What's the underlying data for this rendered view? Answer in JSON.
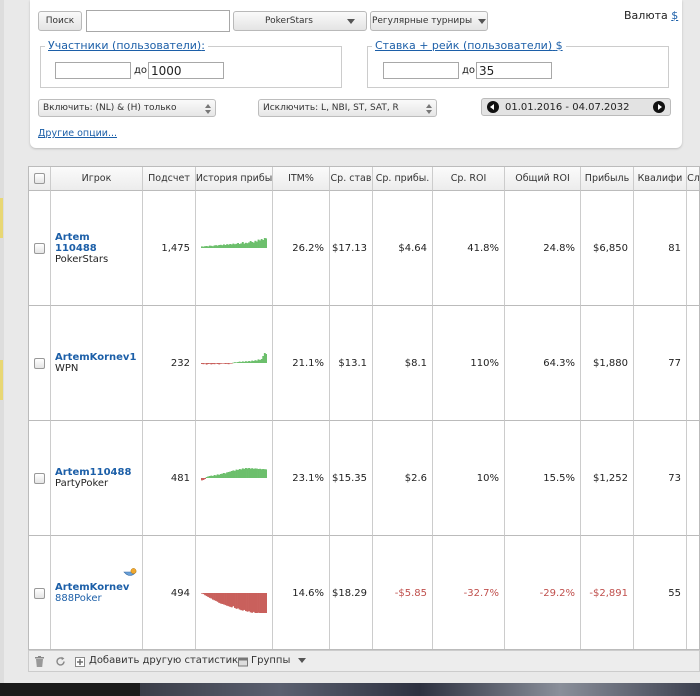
{
  "filters": {
    "search_button": "Поиск",
    "search_value": "",
    "site_select": "PokerStars",
    "tourney_select": "Регулярные турниры",
    "currency_label": "Валюта",
    "currency_symbol": "$",
    "participants": {
      "legend": "Участники (пользователи)",
      "legend_suffix": ":",
      "from": "",
      "to_label": "до",
      "to": "1000"
    },
    "stake": {
      "legend": "Ставка + рейк (пользователи)",
      "legend_symbol": "$",
      "from": "",
      "to_label": "до",
      "to": "35"
    },
    "include_select": "Включить: (NL) & (H) только",
    "exclude_select": "Исключить: L, NBI, ST, SAT, R",
    "date_range": "01.01.2016 - 04.07.2032",
    "more_options": "Другие опции..."
  },
  "table": {
    "headers": [
      "Игрок",
      "Подсчет",
      "История прибы",
      "ITM%",
      "Ср. став",
      "Ср. прибы.",
      "Ср. ROI",
      "Общий ROI",
      "Прибыль",
      "Квалифи",
      "Сл"
    ],
    "rows": [
      {
        "name": "Artem",
        "name2": "110488",
        "site": "PokerStars",
        "count": "1,475",
        "itm": "26.2%",
        "avg_stake": "$17.13",
        "avg_profit": "$4.64",
        "avg_roi": "41.8%",
        "total_roi": "24.8%",
        "profit": "$6,850",
        "qual": "81",
        "negative": false,
        "history": [
          0.08,
          0.07,
          0.09,
          0.1,
          0.08,
          0.12,
          0.11,
          0.09,
          0.13,
          0.14,
          0.12,
          0.15,
          0.16,
          0.14,
          0.18,
          0.15,
          0.19,
          0.17,
          0.2,
          0.18,
          0.22,
          0.19,
          0.21,
          0.25,
          0.2,
          0.23,
          0.3,
          0.22,
          0.26,
          0.24,
          0.28,
          0.35,
          0.3,
          0.27,
          0.36,
          0.32,
          0.42,
          0.38,
          0.45,
          0.4,
          0.5,
          0.48
        ]
      },
      {
        "name": "ArtemKornev1",
        "name2": "",
        "site": "WPN",
        "count": "232",
        "itm": "21.1%",
        "avg_stake": "$13.1",
        "avg_profit": "$8.1",
        "avg_roi": "110%",
        "total_roi": "64.3%",
        "profit": "$1,880",
        "qual": "77",
        "negative": false,
        "history": [
          -0.05,
          -0.06,
          -0.03,
          -0.08,
          -0.05,
          -0.04,
          -0.07,
          -0.05,
          -0.06,
          -0.03,
          -0.05,
          -0.07,
          -0.04,
          -0.03,
          -0.02,
          -0.05,
          -0.04,
          -0.06,
          -0.03,
          -0.01,
          0.02,
          0.04,
          0.03,
          0.05,
          0.07,
          0.05,
          0.08,
          0.06,
          0.09,
          0.07,
          0.1,
          0.08,
          0.12,
          0.1,
          0.14,
          0.12,
          0.18,
          0.15,
          0.2,
          0.35,
          0.5,
          0.45
        ]
      },
      {
        "name": "Artem110488",
        "name2": "",
        "site": "PartyPoker",
        "count": "481",
        "itm": "23.1%",
        "avg_stake": "$15.35",
        "avg_profit": "$2.6",
        "avg_roi": "10%",
        "total_roi": "15.5%",
        "profit": "$1,252",
        "qual": "73",
        "negative": false,
        "history": [
          -0.12,
          -0.1,
          -0.05,
          0.05,
          0.08,
          0.1,
          0.12,
          0.1,
          0.15,
          0.13,
          0.18,
          0.16,
          0.2,
          0.22,
          0.25,
          0.23,
          0.28,
          0.3,
          0.32,
          0.35,
          0.38,
          0.36,
          0.42,
          0.4,
          0.45,
          0.43,
          0.48,
          0.46,
          0.5,
          0.48,
          0.5,
          0.47,
          0.49,
          0.46,
          0.48,
          0.47,
          0.45,
          0.46,
          0.44,
          0.45,
          0.44,
          0.43
        ]
      },
      {
        "name": "ArtemKornev",
        "name2": "",
        "site": "888Poker",
        "count": "494",
        "itm": "14.6%",
        "avg_stake": "$18.29",
        "avg_profit": "-$5.85",
        "avg_roi": "-32.7%",
        "total_roi": "-29.2%",
        "profit": "-$2,891",
        "qual": "55",
        "negative": true,
        "history": [
          -0.02,
          -0.05,
          -0.1,
          -0.14,
          -0.18,
          -0.22,
          -0.25,
          -0.3,
          -0.33,
          -0.36,
          -0.4,
          -0.45,
          -0.48,
          -0.5,
          -0.52,
          -0.55,
          -0.58,
          -0.6,
          -0.63,
          -0.65,
          -0.6,
          -0.68,
          -0.72,
          -0.7,
          -0.75,
          -0.78,
          -0.8,
          -0.77,
          -0.82,
          -0.85,
          -0.83,
          -0.88,
          -0.9,
          -0.86,
          -0.92,
          -0.95,
          -0.9,
          -0.97,
          -1.0,
          -0.98,
          -1.0,
          -0.99
        ]
      }
    ]
  },
  "footer": {
    "add_stat": "Добавить другую статистику",
    "groups": "Группы"
  },
  "colors": {
    "positive": "#6cbf6c",
    "negative": "#c9605c",
    "link": "#1c5fa8"
  }
}
